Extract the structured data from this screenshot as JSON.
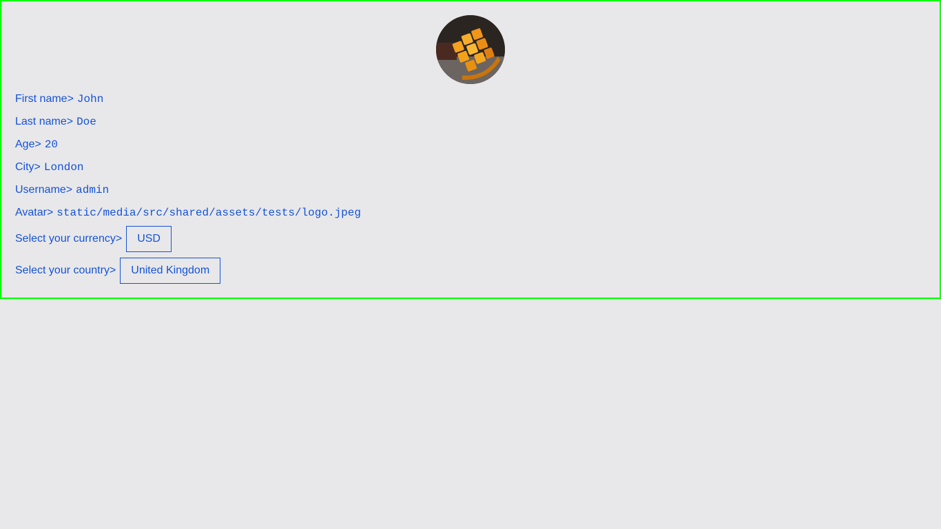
{
  "profile": {
    "avatar_icon": "mango-photo-avatar",
    "fields": [
      {
        "label": "First name>",
        "value": "John"
      },
      {
        "label": "Last name>",
        "value": "Doe"
      },
      {
        "label": "Age>",
        "value": "20"
      },
      {
        "label": "City>",
        "value": "London"
      },
      {
        "label": "Username>",
        "value": "admin"
      },
      {
        "label": "Avatar>",
        "value": "static/media/src/shared/assets/tests/logo.jpeg"
      }
    ],
    "currency": {
      "label": "Select your currency>",
      "selected": "USD"
    },
    "country": {
      "label": "Select your country>",
      "selected": "United Kingdom"
    }
  },
  "colors": {
    "text": "#1552d6",
    "border_highlight": "#00ff00",
    "background": "#e8e8ea"
  }
}
